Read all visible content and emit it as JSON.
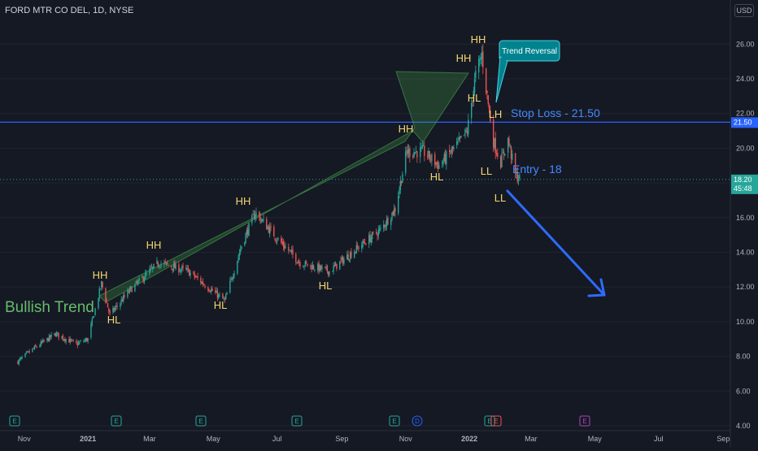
{
  "header": {
    "ticker": "FORD MTR CO DEL, 1D, NYSE",
    "currency_button": "USD"
  },
  "axes": {
    "y_ticks": [
      "26.00",
      "24.00",
      "22.00",
      "20.00",
      "18.00",
      "16.00",
      "14.00",
      "12.00",
      "10.00",
      "8.00",
      "6.00",
      "4.00"
    ],
    "x_ticks": [
      "Nov",
      "2021",
      "Mar",
      "May",
      "Jul",
      "Sep",
      "Nov",
      "2022",
      "Mar",
      "May",
      "Jul",
      "Sep"
    ]
  },
  "price_tags": {
    "stop": {
      "value": "21.50",
      "color": "#2962ff"
    },
    "last": {
      "value": "18.20",
      "countdown": "45:48",
      "color": "#26a69a"
    }
  },
  "annotations": {
    "bullish_trend": "Bullish Trend",
    "trend_reversal": "Trend Reversal",
    "stop_loss": "Stop Loss - 21.50",
    "entry": "Entry - 18",
    "swing_labels": [
      "HH",
      "HL",
      "HH",
      "HL",
      "HH",
      "HL",
      "HH",
      "HL",
      "HH",
      "HH",
      "HL",
      "LH",
      "LL",
      "LL"
    ]
  },
  "event_markers": [
    "E",
    "E",
    "E",
    "E",
    "E",
    "D",
    "E",
    "E",
    "E"
  ],
  "colors": {
    "up": "#26a69a",
    "down": "#ef5350",
    "label": "#f5d76e",
    "trend_text": "#66bb6a",
    "blue": "#2962ff",
    "bg": "#151924"
  },
  "chart_data": {
    "type": "candlestick",
    "title": "FORD MTR CO DEL, 1D, NYSE",
    "currency": "USD",
    "ylim": [
      4.0,
      26.5
    ],
    "xlim": [
      "2020-10-26",
      "2022-09-20"
    ],
    "last_price": 18.2,
    "horizontal_lines": [
      21.5,
      18.2
    ],
    "closes_anchor_points": [
      {
        "date": "2020-10-26",
        "close": 7.7
      },
      {
        "date": "2020-11-09",
        "close": 8.4
      },
      {
        "date": "2020-12-01",
        "close": 9.3
      },
      {
        "date": "2020-12-21",
        "close": 8.7
      },
      {
        "date": "2021-01-01",
        "close": 9.0
      },
      {
        "date": "2021-01-14",
        "close": 12.2
      },
      {
        "date": "2021-01-22",
        "close": 10.4
      },
      {
        "date": "2021-02-10",
        "close": 11.8
      },
      {
        "date": "2021-03-10",
        "close": 13.4
      },
      {
        "date": "2021-04-07",
        "close": 12.9
      },
      {
        "date": "2021-05-12",
        "close": 11.2
      },
      {
        "date": "2021-05-28",
        "close": 14.4
      },
      {
        "date": "2021-06-10",
        "close": 16.3
      },
      {
        "date": "2021-07-01",
        "close": 14.8
      },
      {
        "date": "2021-07-23",
        "close": 13.4
      },
      {
        "date": "2021-08-20",
        "close": 12.9
      },
      {
        "date": "2021-09-15",
        "close": 14.2
      },
      {
        "date": "2021-10-08",
        "close": 15.3
      },
      {
        "date": "2021-10-22",
        "close": 16.5
      },
      {
        "date": "2021-11-02",
        "close": 19.8
      },
      {
        "date": "2021-11-18",
        "close": 19.8
      },
      {
        "date": "2021-12-03",
        "close": 19.0
      },
      {
        "date": "2021-12-22",
        "close": 20.3
      },
      {
        "date": "2021-12-30",
        "close": 21.0
      },
      {
        "date": "2022-01-07",
        "close": 24.2
      },
      {
        "date": "2022-01-13",
        "close": 25.4
      },
      {
        "date": "2022-01-18",
        "close": 23.0
      },
      {
        "date": "2022-01-24",
        "close": 20.4
      },
      {
        "date": "2022-01-31",
        "close": 19.2
      },
      {
        "date": "2022-02-07",
        "close": 20.5
      },
      {
        "date": "2022-02-14",
        "close": 18.5
      },
      {
        "date": "2022-02-18",
        "close": 18.2
      }
    ],
    "swing_points": [
      {
        "label": "HH",
        "date": "2021-01-15",
        "value": 12.3
      },
      {
        "label": "HL",
        "date": "2021-01-28",
        "value": 10.4
      },
      {
        "label": "HH",
        "date": "2021-03-11",
        "value": 13.6
      },
      {
        "label": "HL",
        "date": "2021-05-12",
        "value": 11.2
      },
      {
        "label": "HH",
        "date": "2021-06-11",
        "value": 16.5
      },
      {
        "label": "HL",
        "date": "2021-08-19",
        "value": 12.5
      },
      {
        "label": "HH",
        "date": "2021-11-05",
        "value": 20.1
      },
      {
        "label": "HL",
        "date": "2021-11-30",
        "value": 18.6
      },
      {
        "label": "HH",
        "date": "2022-01-07",
        "value": 24.5
      },
      {
        "label": "HH",
        "date": "2022-01-13",
        "value": 25.8
      },
      {
        "label": "HL",
        "date": "2022-01-18",
        "value": 22.5
      },
      {
        "label": "LH",
        "date": "2022-02-08",
        "value": 21.0
      },
      {
        "label": "LL",
        "date": "2022-01-31",
        "value": 18.9
      },
      {
        "label": "LL",
        "date": "2022-02-15",
        "value": 17.6
      }
    ]
  }
}
